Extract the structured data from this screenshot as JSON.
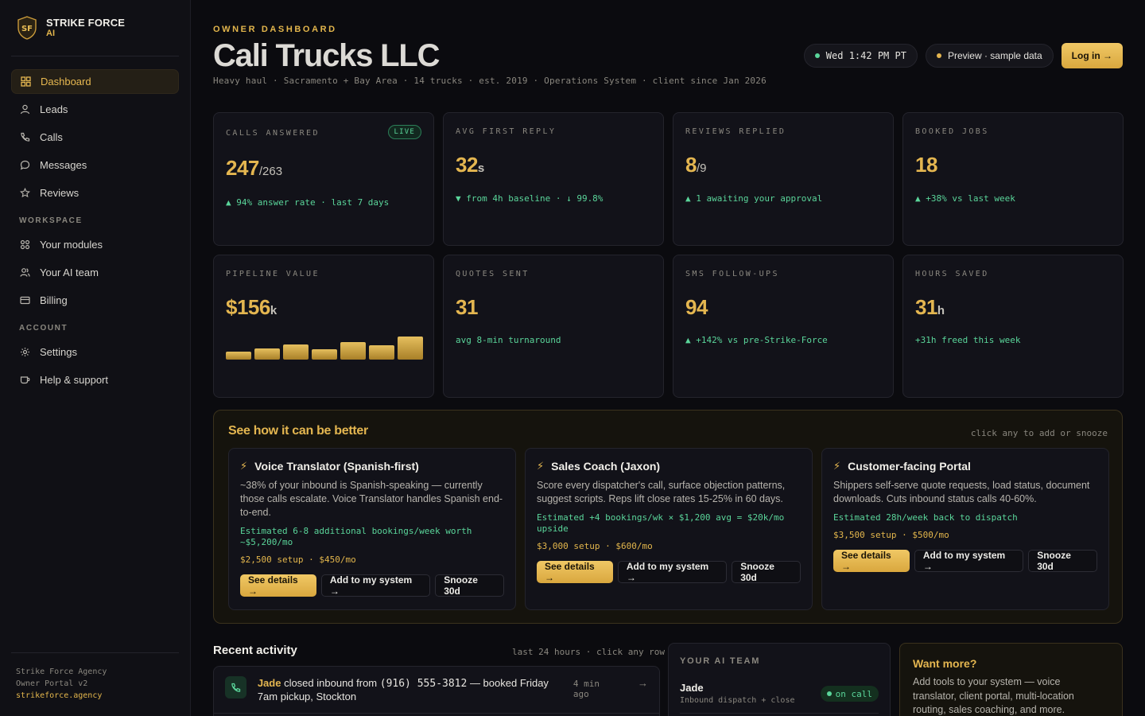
{
  "brand": {
    "name": "STRIKE FORCE",
    "sub": "AI",
    "logo_text": "SF"
  },
  "nav": {
    "main": [
      {
        "label": "Dashboard",
        "icon": "grid-icon",
        "active": true
      },
      {
        "label": "Leads",
        "icon": "user-icon"
      },
      {
        "label": "Calls",
        "icon": "phone-icon"
      },
      {
        "label": "Messages",
        "icon": "chat-bubble-icon"
      },
      {
        "label": "Reviews",
        "icon": "star-icon"
      }
    ],
    "workspace_label": "WORKSPACE",
    "workspace": [
      {
        "label": "Your modules",
        "icon": "modules-icon"
      },
      {
        "label": "Your AI team",
        "icon": "team-icon"
      },
      {
        "label": "Billing",
        "icon": "card-icon"
      }
    ],
    "account_label": "ACCOUNT",
    "account": [
      {
        "label": "Settings",
        "icon": "gear-icon"
      },
      {
        "label": "Help & support",
        "icon": "cup-icon"
      }
    ]
  },
  "footer": {
    "line1": "Strike Force Agency",
    "line2": "Owner Portal v2",
    "link": "strikeforce.agency"
  },
  "header": {
    "eyebrow": "OWNER DASHBOARD",
    "title": "Cali Trucks LLC",
    "subtitle": "Heavy haul · Sacramento + Bay Area · 14 trucks · est. 2019 · Operations System · client since Jan 2026",
    "clock": "Wed 1:42 PM PT",
    "preview": "Preview · sample data",
    "login": "Log in →"
  },
  "stats": [
    {
      "label": "CALLS ANSWERED",
      "badge": "LIVE",
      "value": "247",
      "suffix": "/263",
      "note": "▲ 94% answer rate · last 7 days"
    },
    {
      "label": "AVG FIRST REPLY",
      "value": "32",
      "unit": "s",
      "note": "▼ from 4h baseline · ↓ 99.8%"
    },
    {
      "label": "REVIEWS REPLIED",
      "value": "8",
      "suffix": "/9",
      "note": "▲ 1 awaiting your approval"
    },
    {
      "label": "BOOKED JOBS",
      "value": "18",
      "note": "▲ +38% vs last week"
    },
    {
      "label": "PIPELINE VALUE",
      "value": "$156",
      "unit": "k",
      "note": "",
      "sparkline": [
        0.3,
        0.45,
        0.6,
        0.4,
        0.7,
        0.55,
        0.9
      ]
    },
    {
      "label": "QUOTES SENT",
      "value": "31",
      "note": "avg 8-min turnaround"
    },
    {
      "label": "SMS FOLLOW-UPS",
      "value": "94",
      "note": "▲ +142% vs pre-Strike-Force"
    },
    {
      "label": "HOURS SAVED",
      "value": "31",
      "unit": "h",
      "note": "+31h freed this week"
    }
  ],
  "better": {
    "title": "See how it can be better",
    "hint": "click any to add or snooze",
    "recs": [
      {
        "title": "Voice Translator (Spanish-first)",
        "desc": "~38% of your inbound is Spanish-speaking — currently those calls escalate. Voice Translator handles Spanish end-to-end.",
        "estimate": "Estimated 6-8 additional bookings/week worth ~$5,200/mo",
        "price": "$2,500 setup · $450/mo",
        "details": "See details →",
        "add": "Add to my system →",
        "snooze": "Snooze 30d"
      },
      {
        "title": "Sales Coach (Jaxon)",
        "desc": "Score every dispatcher's call, surface objection patterns, suggest scripts. Reps lift close rates 15-25% in 60 days.",
        "estimate": "Estimated +4 bookings/wk × $1,200 avg = $20k/mo upside",
        "price": "$3,000 setup · $600/mo",
        "details": "See details →",
        "add": "Add to my system →",
        "snooze": "Snooze 30d"
      },
      {
        "title": "Customer-facing Portal",
        "desc": "Shippers self-serve quote requests, load status, document downloads. Cuts inbound status calls 40-60%.",
        "estimate": "Estimated 28h/week back to dispatch",
        "price": "$3,500 setup · $500/mo",
        "details": "See details →",
        "add": "Add to my system →",
        "snooze": "Snooze 30d"
      }
    ]
  },
  "recent": {
    "title": "Recent activity",
    "hint": "last 24 hours · click any row",
    "rows": [
      {
        "who": "Jade",
        "text_pre": " closed inbound from ",
        "phone": "(916) 555-3812",
        "text_post": " — booked Friday 7am pickup, Stockton",
        "time": "4 min ago",
        "arrow": "→"
      }
    ]
  },
  "team": {
    "label": "YOUR AI TEAM",
    "members": [
      {
        "name": "Jade",
        "role": "Inbound dispatch + close",
        "status": "on call"
      }
    ]
  },
  "want": {
    "title": "Want more?",
    "desc": "Add tools to your system — voice translator, client portal, multi-location routing, sales coaching, and more."
  },
  "colors": {
    "accent": "#e4b650",
    "positive": "#5ad59a",
    "bg": "#0b0b0f",
    "panel": "#121219"
  }
}
